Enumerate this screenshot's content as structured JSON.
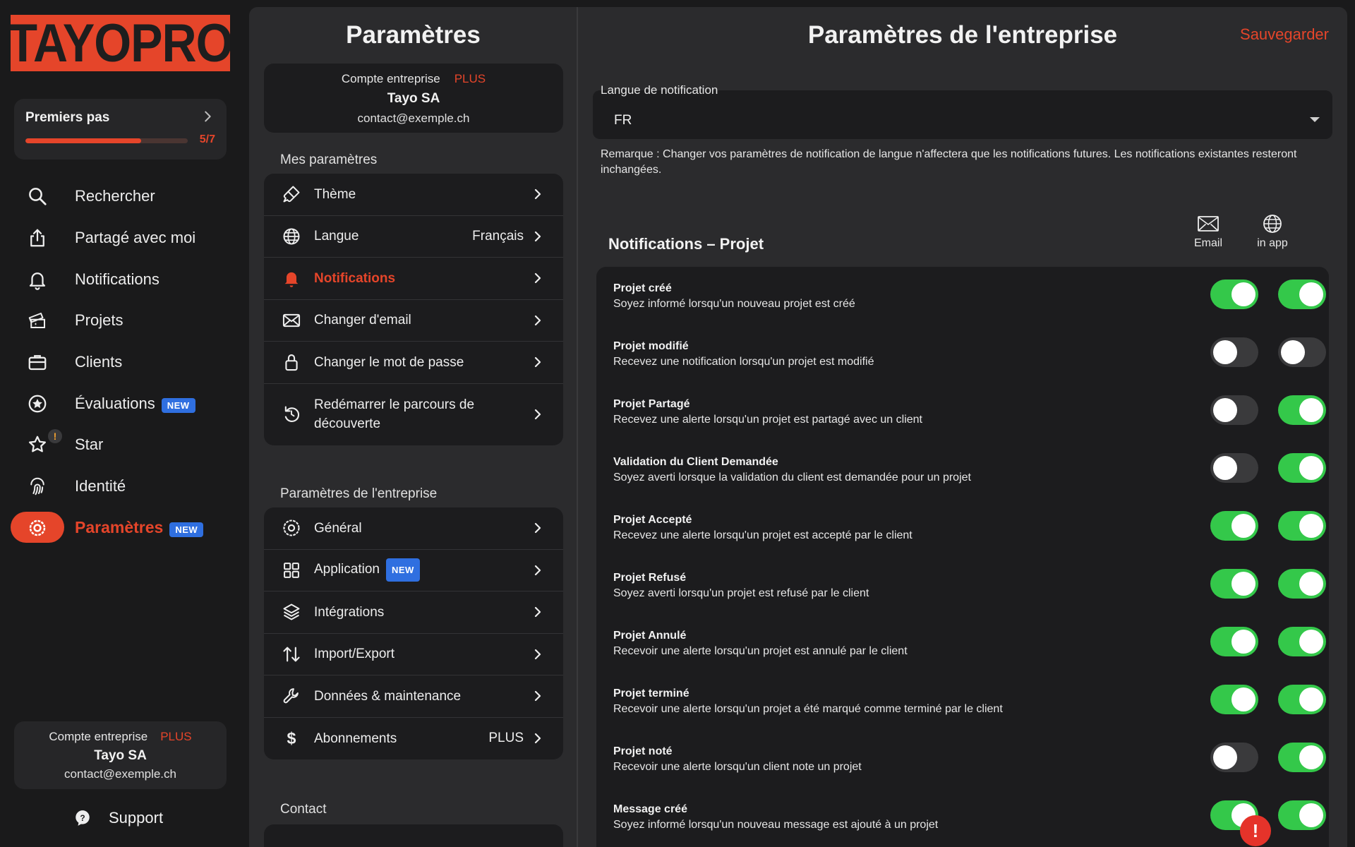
{
  "logo": {
    "text": "TAYOPRO"
  },
  "onboarding": {
    "title": "Premiers pas",
    "progress_text": "5/7",
    "progress_fraction": 0.714
  },
  "sidebar": {
    "items": [
      {
        "label": "Rechercher",
        "icon": "search-icon"
      },
      {
        "label": "Partagé avec moi",
        "icon": "share-icon"
      },
      {
        "label": "Notifications",
        "icon": "bell-icon"
      },
      {
        "label": "Projets",
        "icon": "tickets-icon"
      },
      {
        "label": "Clients",
        "icon": "briefcase-icon"
      },
      {
        "label": "Évaluations",
        "icon": "star-circle-icon",
        "badge": "NEW"
      },
      {
        "label": "Star",
        "icon": "star-icon",
        "alert": "!"
      },
      {
        "label": "Identité",
        "icon": "fingerprint-icon"
      },
      {
        "label": "Paramètres",
        "icon": "settings-icon",
        "badge": "NEW",
        "active": true
      }
    ],
    "account": {
      "type": "Compte entreprise",
      "plan": "PLUS",
      "name": "Tayo SA",
      "email": "contact@exemple.ch"
    },
    "support": "Support"
  },
  "settings": {
    "title": "Paramètres",
    "account": {
      "type": "Compte entreprise",
      "plan": "PLUS",
      "name": "Tayo SA",
      "email": "contact@exemple.ch"
    },
    "my_section": "Mes paramètres",
    "my_items": [
      {
        "label": "Thème",
        "icon": "brush-icon"
      },
      {
        "label": "Langue",
        "value": "Français",
        "icon": "globe-icon"
      },
      {
        "label": "Notifications",
        "icon": "bell-icon",
        "active": true
      },
      {
        "label": "Changer d'email",
        "icon": "envelope-icon"
      },
      {
        "label": "Changer le mot de passe",
        "icon": "lock-icon"
      },
      {
        "label": "Redémarrer le parcours de découverte",
        "icon": "restart-icon"
      }
    ],
    "company_section": "Paramètres de l'entreprise",
    "company_items": [
      {
        "label": "Général",
        "icon": "gear-icon"
      },
      {
        "label": "Application",
        "badge": "NEW",
        "icon": "grid-icon"
      },
      {
        "label": "Intégrations",
        "icon": "layers-icon"
      },
      {
        "label": "Import/Export",
        "icon": "import-export-icon"
      },
      {
        "label": "Données & maintenance",
        "icon": "wrench-icon"
      },
      {
        "label": "Abonnements",
        "value": "PLUS",
        "icon": "dollar-icon"
      }
    ],
    "contact_section": "Contact"
  },
  "main": {
    "title": "Paramètres de l'entreprise",
    "save_label": "Sauvegarder",
    "language": {
      "label": "Langue de notification",
      "value": "FR"
    },
    "remark": "Remarque : Changer vos paramètres de notification de langue n'affectera que les notifications futures. Les notifications existantes resteront inchangées.",
    "notif_section": "Notifications – Projet",
    "columns": {
      "email": "Email",
      "inapp": "in app"
    },
    "notifications": [
      {
        "title": "Projet créé",
        "desc": "Soyez informé lorsqu'un nouveau projet est créé",
        "email": true,
        "inapp": true
      },
      {
        "title": "Projet modifié",
        "desc": "Recevez une notification lorsqu'un projet est modifié",
        "email": false,
        "inapp": false
      },
      {
        "title": "Projet Partagé",
        "desc": "Recevez une alerte lorsqu'un projet est partagé avec un client",
        "email": false,
        "inapp": true
      },
      {
        "title": "Validation du Client Demandée",
        "desc": "Soyez averti lorsque la validation du client est demandée pour un projet",
        "email": false,
        "inapp": true
      },
      {
        "title": "Projet Accepté",
        "desc": "Recevez une alerte lorsqu'un projet est accepté par le client",
        "email": true,
        "inapp": true
      },
      {
        "title": "Projet Refusé",
        "desc": "Soyez averti lorsqu'un projet est refusé par le client",
        "email": true,
        "inapp": true
      },
      {
        "title": "Projet Annulé",
        "desc": "Recevoir une alerte lorsqu'un projet est annulé par le client",
        "email": true,
        "inapp": true
      },
      {
        "title": "Projet terminé",
        "desc": "Recevoir une alerte lorsqu'un projet a été marqué comme terminé par le client",
        "email": true,
        "inapp": true
      },
      {
        "title": "Projet noté",
        "desc": "Recevoir une alerte lorsqu'un client note un projet",
        "email": false,
        "inapp": true
      },
      {
        "title": "Message créé",
        "desc": "Soyez informé lorsqu'un nouveau message est ajouté à un projet",
        "email": true,
        "inapp": true
      }
    ],
    "alert": "!"
  },
  "colors": {
    "accent": "#e5452a",
    "toggle_on": "#34c84a",
    "badge_new": "#2f6fe0"
  }
}
